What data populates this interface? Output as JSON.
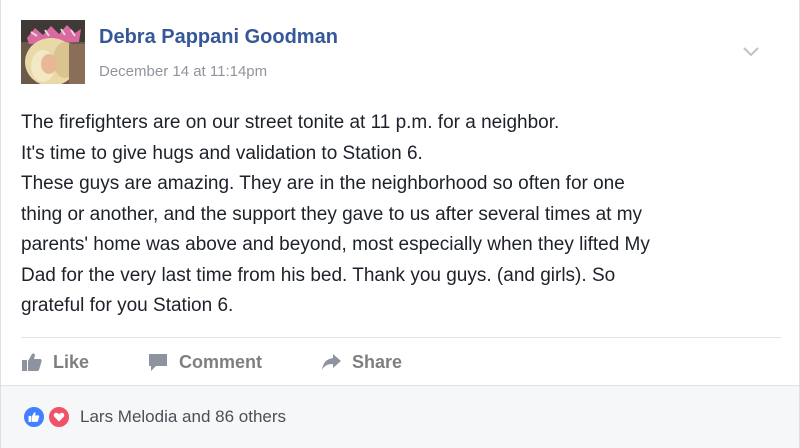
{
  "post": {
    "author": "Debra Pappani Goodman",
    "timestamp": "December 14 at 11:14pm",
    "body_lines": [
      "The firefighters are on our street tonite at 11 p.m. for a neighbor.",
      "It's time to give hugs and validation to Station 6.",
      "These guys are amazing. They are in the neighborhood so often for one",
      "thing or another, and the support they gave to us after several times at my",
      "parents' home was above and beyond, most especially when they lifted My",
      "Dad for the very last time from his bed. Thank you guys. (and girls). So",
      "grateful for you Station 6."
    ],
    "menu_icon": "chevron-down-icon"
  },
  "actions": {
    "like_label": "Like",
    "comment_label": "Comment",
    "share_label": "Share",
    "like_icon": "thumbs-up-icon",
    "comment_icon": "speech-bubble-icon",
    "share_icon": "share-arrow-icon"
  },
  "reactions": {
    "summary": "Lars Melodia and 86 others",
    "types": [
      "like-reaction-icon",
      "love-reaction-icon"
    ]
  },
  "colors": {
    "author_link": "#365899",
    "timestamp": "#90949c",
    "body_text": "#1d2129",
    "action_text": "#7f7f7f",
    "like_reaction": "#4080ff",
    "love_reaction": "#f25268",
    "footer_bg": "#f6f7f9"
  }
}
